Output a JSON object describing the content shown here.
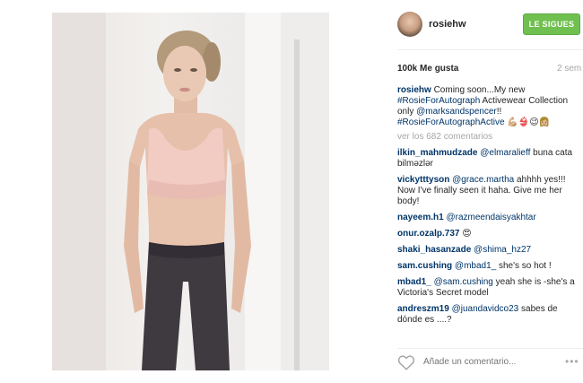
{
  "post": {
    "image_alt": "Woman in pink sports bra and dark leggings"
  },
  "header": {
    "username": "rosiehw",
    "follow_label": "LE SIGUES"
  },
  "stats": {
    "likes": "100k Me gusta",
    "time": "2 sem"
  },
  "caption": {
    "user": "rosiehw",
    "text1": " Coming soon...My new ",
    "tag1": "#RosieForAutograph",
    "text2": " Activewear Collection only ",
    "mention": "@marksandspencer",
    "text3": "!! ",
    "tag2": "#RosieForAutographActive",
    "emoji": " 💪🏼👙😉👩🏼"
  },
  "view_all": "ver los 682 comentarios",
  "comments": [
    {
      "user": "ilkin_mahmudzade",
      "mention": "@elmaralieff",
      "text": " buna cata bilməzlər"
    },
    {
      "user": "vickytttyson",
      "mention": "@grace.martha",
      "text": " ahhhh yes!!! Now I've finally seen it haha. Give me her body!"
    },
    {
      "user": "nayeem.h1",
      "mention": "@razmeendaisyakhtar",
      "text": ""
    },
    {
      "user": "onur.ozalp.737",
      "mention": "",
      "text": " 😍"
    },
    {
      "user": "shaki_hasanzade",
      "mention": "@shima_hz27",
      "text": ""
    },
    {
      "user": "sam.cushing",
      "mention": "@mbad1_",
      "text": " she's so hot !"
    },
    {
      "user": "mbad1_",
      "mention": "@sam.cushing",
      "text": " yeah she is -she's a Victoria's Secret model"
    },
    {
      "user": "andreszm19",
      "mention": "@juandavidco23",
      "text": " sabes de dónde es ....?"
    }
  ],
  "footer": {
    "comment_placeholder": "Añade un comentario...",
    "more": "•••"
  },
  "icons": {
    "like": "heart-icon",
    "options": "more-options-icon"
  },
  "colors": {
    "follow_button": "#70c050",
    "link": "#003569",
    "muted": "#a5a7aa"
  }
}
